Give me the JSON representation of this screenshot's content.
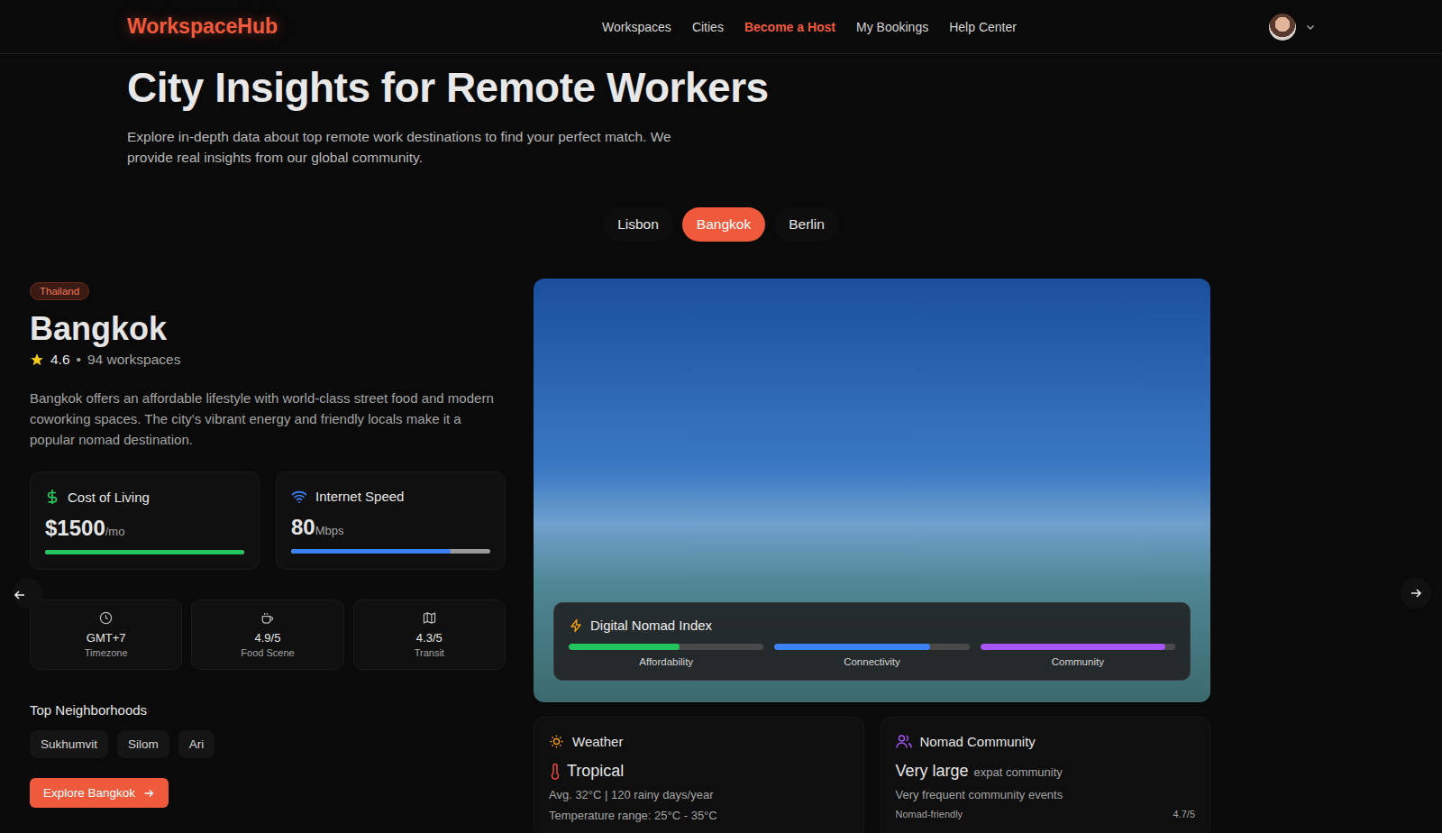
{
  "header": {
    "logo": "WorkspaceHub",
    "nav": [
      {
        "label": "Workspaces",
        "selected": false
      },
      {
        "label": "Cities",
        "selected": false
      },
      {
        "label": "Become a Host",
        "selected": true
      },
      {
        "label": "My Bookings",
        "selected": false
      },
      {
        "label": "Help Center",
        "selected": false
      }
    ]
  },
  "hero": {
    "title": "City Insights for Remote Workers",
    "subtitle": "Explore in-depth data about top remote work destinations to find your perfect match. We provide real insights from our global community."
  },
  "city_tabs": [
    {
      "label": "Lisbon",
      "selected": false
    },
    {
      "label": "Bangkok",
      "selected": true
    },
    {
      "label": "Berlin",
      "selected": false
    }
  ],
  "city": {
    "country": "Thailand",
    "name": "Bangkok",
    "rating": "4.6",
    "separator": "•",
    "workspaces": "94 workspaces",
    "description": "Bangkok offers an affordable lifestyle with world-class street food and modern coworking spaces. The city's vibrant energy and friendly locals make it a popular nomad destination.",
    "stats": [
      {
        "kind": "cost",
        "label": "Cost of Living",
        "value": "$1500",
        "unit": "/mo",
        "level": 1.0,
        "color": "#22c55e"
      },
      {
        "kind": "internet",
        "label": "Internet Speed",
        "value": "80",
        "unit": "Mbps",
        "level": 0.8,
        "color": "#3b82f6"
      }
    ],
    "facts": [
      {
        "kind": "clock",
        "value": "GMT+7",
        "label": "Timezone"
      },
      {
        "kind": "cup",
        "value": "4.9/5",
        "label": "Food Scene"
      },
      {
        "kind": "map",
        "value": "4.3/5",
        "label": "Transit"
      }
    ],
    "neighborhoods_title": "Top Neighborhoods",
    "neighborhoods": [
      "Sukhumvit",
      "Silom",
      "Ari"
    ],
    "explore_button": "Explore Bangkok"
  },
  "nomad_index": {
    "title": "Digital Nomad Index",
    "bars": [
      {
        "label": "Affordability",
        "level": 0.57,
        "color": "#22c55e"
      },
      {
        "label": "Connectivity",
        "level": 0.8,
        "color": "#3b82f6"
      },
      {
        "label": "Community",
        "level": 0.95,
        "color": "#a855f7"
      }
    ]
  },
  "weather": {
    "title": "Weather",
    "type": "Tropical",
    "lines": [
      "Avg. 32°C | 120 rainy days/year",
      "Temperature range: 25°C - 35°C"
    ]
  },
  "community": {
    "title": "Nomad Community",
    "size": "Very large",
    "size_suffix": "expat community",
    "events": "Very frequent community events",
    "metric_label": "Nomad-friendly",
    "metric_value": "4.7/5"
  }
}
